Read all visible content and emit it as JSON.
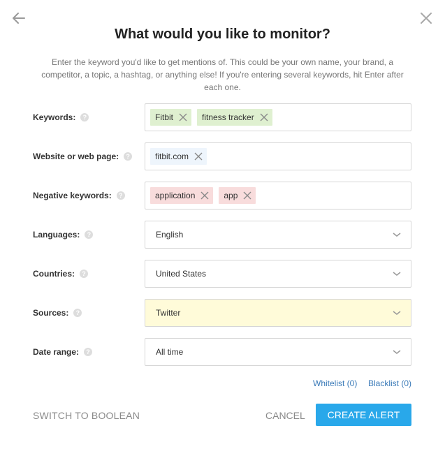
{
  "dialog": {
    "title": "What would you like to monitor?",
    "description": "Enter the keyword you'd like to get mentions of. This could be your own name, your brand, a competitor, a topic, a hashtag, or anything else! If you're entering several keywords, hit Enter after each one."
  },
  "fields": {
    "keywords": {
      "label": "Keywords:",
      "tags": [
        "Fitbit",
        "fitness tracker"
      ]
    },
    "website": {
      "label": "Website or web page:",
      "tags": [
        "fitbit.com"
      ]
    },
    "negative": {
      "label": "Negative keywords:",
      "tags": [
        "application",
        "app"
      ]
    },
    "languages": {
      "label": "Languages:",
      "value": "English"
    },
    "countries": {
      "label": "Countries:",
      "value": "United States"
    },
    "sources": {
      "label": "Sources:",
      "value": "Twitter"
    },
    "date_range": {
      "label": "Date range:",
      "value": "All time"
    }
  },
  "help_icon": "?",
  "links": {
    "whitelist": "Whitelist (0)",
    "blacklist": "Blacklist (0)"
  },
  "actions": {
    "switch_boolean": "SWITCH TO BOOLEAN",
    "cancel": "CANCEL",
    "create": "CREATE ALERT"
  },
  "colors": {
    "primary_button": "#29a8ea",
    "link": "#3a7ab8",
    "tag_keyword": "#dff0d0",
    "tag_website": "#eef5fc",
    "tag_negative": "#f8dcdc",
    "sources_highlight": "#fffbd9"
  }
}
